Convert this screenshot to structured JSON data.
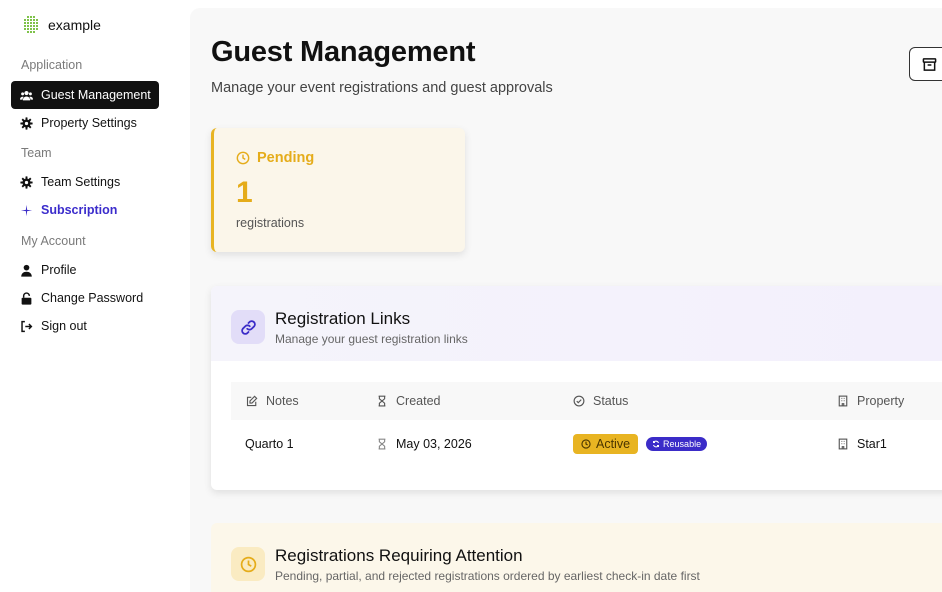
{
  "app": {
    "name": "example",
    "logo_icon": "grid-logo-icon"
  },
  "sidebar": {
    "sections": [
      {
        "label": "Application"
      },
      {
        "label": "Team"
      },
      {
        "label": "My Account"
      }
    ],
    "items": [
      {
        "label": "Guest Management",
        "icon": "users-icon",
        "active": true
      },
      {
        "label": "Property Settings",
        "icon": "gear-icon"
      },
      {
        "label": "Team Settings",
        "icon": "gear-icon"
      },
      {
        "label": "Subscription",
        "icon": "sparkle-icon"
      },
      {
        "label": "Profile",
        "icon": "user-icon"
      },
      {
        "label": "Change Password",
        "icon": "lock-icon"
      },
      {
        "label": "Sign out",
        "icon": "sign-out-icon"
      }
    ]
  },
  "header": {
    "title": "Guest Management",
    "subtitle": "Manage your event registrations and guest approvals",
    "action_icon": "archive-icon"
  },
  "pending": {
    "title": "Pending",
    "count": "1",
    "unit": "registrations",
    "icon": "clock-icon"
  },
  "registration_links": {
    "title": "Registration Links",
    "subtitle": "Manage your guest registration links",
    "icon": "link-icon",
    "columns": [
      {
        "label": "Notes",
        "icon": "edit-icon"
      },
      {
        "label": "Created",
        "icon": "hourglass-icon"
      },
      {
        "label": "Status",
        "icon": "check-circle-icon"
      },
      {
        "label": "Property",
        "icon": "building-icon"
      }
    ],
    "rows": [
      {
        "notes": "Quarto 1",
        "created": "May 03, 2026",
        "status": "Active",
        "tag": "Reusable",
        "property": "Star1"
      }
    ]
  },
  "attention": {
    "title": "Registrations Requiring Attention",
    "subtitle": "Pending, partial, and rejected registrations ordered by earliest check-in date first",
    "icon": "clock-icon"
  },
  "colors": {
    "accent": "#3b2cc8",
    "pending": "#e5ac1a",
    "active_nav": "#111111"
  }
}
